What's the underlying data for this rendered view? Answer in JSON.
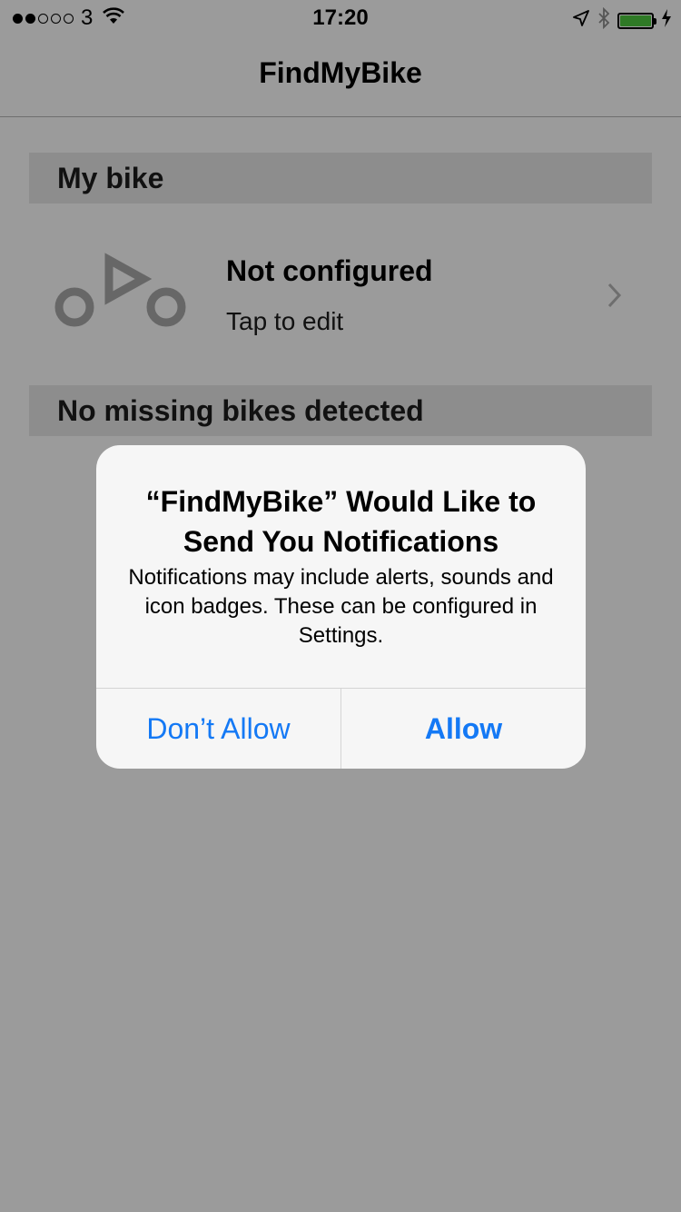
{
  "status_bar": {
    "carrier": "3",
    "time": "17:20",
    "signal_bars_filled": 2,
    "signal_bars_total": 5,
    "battery_level": 1.0
  },
  "nav": {
    "title": "FindMyBike"
  },
  "sections": {
    "my_bike": "My bike",
    "missing": "No missing bikes detected"
  },
  "bike": {
    "title": "Not configured",
    "subtitle": "Tap to edit",
    "icon": "bike-icon"
  },
  "alert": {
    "title": "“FindMyBike” Would Like to Send You Notifications",
    "message": "Notifications may include alerts, sounds and icon badges. These can be configured in Settings.",
    "deny_label": "Don’t Allow",
    "allow_label": "Allow"
  },
  "colors": {
    "overlay": "#9b9b9b",
    "accent": "#1479f5",
    "battery": "#2f7a26"
  }
}
